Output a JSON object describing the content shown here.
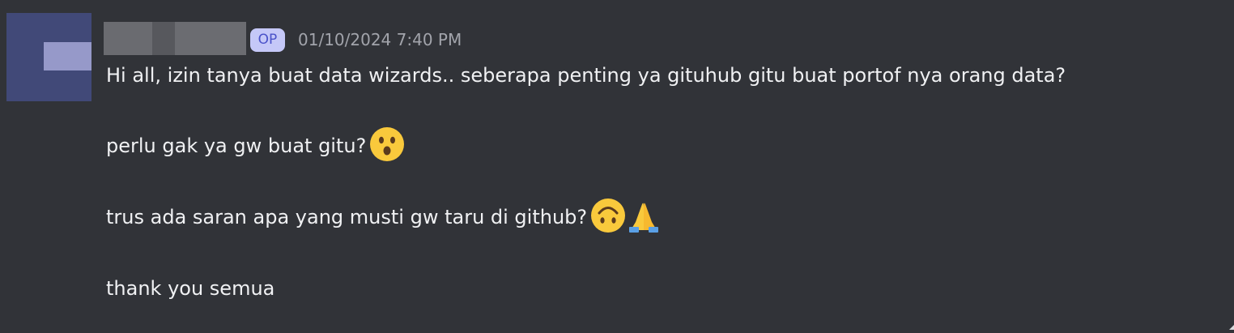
{
  "message": {
    "badge": "OP",
    "timestamp": "01/10/2024 7:40 PM",
    "lines": [
      "Hi all, izin tanya buat data wizards.. seberapa penting ya gituhub gitu buat portof nya orang data?",
      "perlu gak ya gw buat gitu?",
      "trus ada saran apa yang musti gw taru di github?",
      "thank you semua"
    ],
    "emoji": [
      "hushed-face",
      "upside-down-face",
      "folded-hands"
    ]
  },
  "colors": {
    "background": "#313338",
    "text": "#f0f1f3",
    "muted": "#a2a4ab",
    "badge_bg": "#c5c8f8",
    "badge_text": "#4a52c9",
    "avatar": "#414978"
  }
}
